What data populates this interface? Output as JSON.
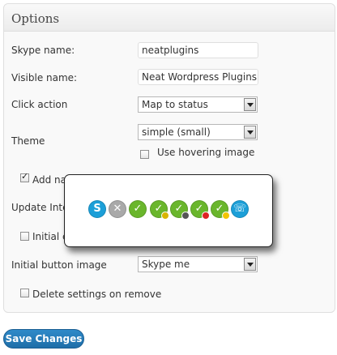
{
  "panel": {
    "title": "Options"
  },
  "form": {
    "skype_name_label": "Skype name:",
    "skype_name_value": "neatplugins",
    "visible_name_label": "Visible name:",
    "visible_name_value": "Neat Wordpress Plugins",
    "click_action_label": "Click action",
    "click_action_value": "Map to status",
    "theme_label": "Theme",
    "theme_value": "simple (small)",
    "hover_label": "Use hovering image",
    "add_label": "Add na",
    "update_label": "Update Inte",
    "initial_label": "Initial c",
    "initial_image_label": "Initial button image",
    "initial_image_value": "Skype me",
    "delete_label": "Delete settings on remove"
  },
  "checkboxes": {
    "hovering_image": false,
    "add": true,
    "initial": false,
    "delete_settings": false
  },
  "popup": {
    "icons": [
      "skype-icon",
      "offline-icon",
      "online-icon",
      "away-icon",
      "na-icon",
      "dnd-icon",
      "skype-me-icon",
      "call-icon"
    ]
  },
  "save_button": "Save Changes",
  "colors": {
    "accent": "#2179b5",
    "online": "#6ab62c",
    "skype": "#1c9fd8"
  }
}
